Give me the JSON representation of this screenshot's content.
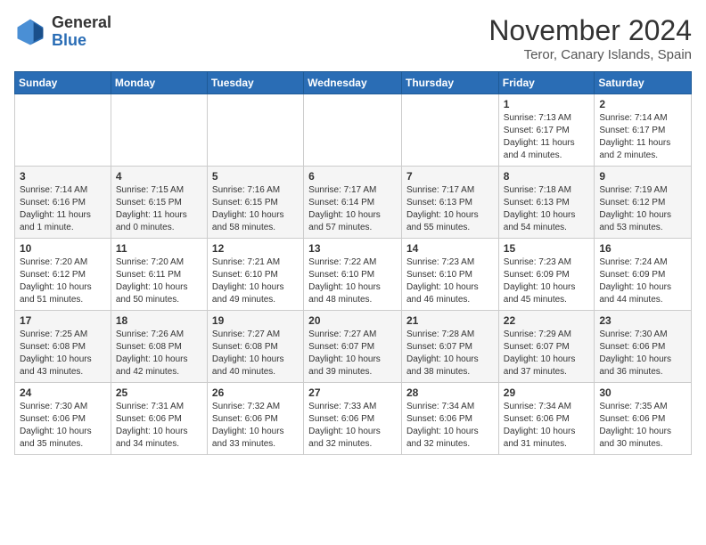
{
  "header": {
    "logo_general": "General",
    "logo_blue": "Blue",
    "month_title": "November 2024",
    "location": "Teror, Canary Islands, Spain"
  },
  "calendar": {
    "days_of_week": [
      "Sunday",
      "Monday",
      "Tuesday",
      "Wednesday",
      "Thursday",
      "Friday",
      "Saturday"
    ],
    "weeks": [
      [
        {
          "num": "",
          "info": ""
        },
        {
          "num": "",
          "info": ""
        },
        {
          "num": "",
          "info": ""
        },
        {
          "num": "",
          "info": ""
        },
        {
          "num": "",
          "info": ""
        },
        {
          "num": "1",
          "info": "Sunrise: 7:13 AM\nSunset: 6:17 PM\nDaylight: 11 hours\nand 4 minutes."
        },
        {
          "num": "2",
          "info": "Sunrise: 7:14 AM\nSunset: 6:17 PM\nDaylight: 11 hours\nand 2 minutes."
        }
      ],
      [
        {
          "num": "3",
          "info": "Sunrise: 7:14 AM\nSunset: 6:16 PM\nDaylight: 11 hours\nand 1 minute."
        },
        {
          "num": "4",
          "info": "Sunrise: 7:15 AM\nSunset: 6:15 PM\nDaylight: 11 hours\nand 0 minutes."
        },
        {
          "num": "5",
          "info": "Sunrise: 7:16 AM\nSunset: 6:15 PM\nDaylight: 10 hours\nand 58 minutes."
        },
        {
          "num": "6",
          "info": "Sunrise: 7:17 AM\nSunset: 6:14 PM\nDaylight: 10 hours\nand 57 minutes."
        },
        {
          "num": "7",
          "info": "Sunrise: 7:17 AM\nSunset: 6:13 PM\nDaylight: 10 hours\nand 55 minutes."
        },
        {
          "num": "8",
          "info": "Sunrise: 7:18 AM\nSunset: 6:13 PM\nDaylight: 10 hours\nand 54 minutes."
        },
        {
          "num": "9",
          "info": "Sunrise: 7:19 AM\nSunset: 6:12 PM\nDaylight: 10 hours\nand 53 minutes."
        }
      ],
      [
        {
          "num": "10",
          "info": "Sunrise: 7:20 AM\nSunset: 6:12 PM\nDaylight: 10 hours\nand 51 minutes."
        },
        {
          "num": "11",
          "info": "Sunrise: 7:20 AM\nSunset: 6:11 PM\nDaylight: 10 hours\nand 50 minutes."
        },
        {
          "num": "12",
          "info": "Sunrise: 7:21 AM\nSunset: 6:10 PM\nDaylight: 10 hours\nand 49 minutes."
        },
        {
          "num": "13",
          "info": "Sunrise: 7:22 AM\nSunset: 6:10 PM\nDaylight: 10 hours\nand 48 minutes."
        },
        {
          "num": "14",
          "info": "Sunrise: 7:23 AM\nSunset: 6:10 PM\nDaylight: 10 hours\nand 46 minutes."
        },
        {
          "num": "15",
          "info": "Sunrise: 7:23 AM\nSunset: 6:09 PM\nDaylight: 10 hours\nand 45 minutes."
        },
        {
          "num": "16",
          "info": "Sunrise: 7:24 AM\nSunset: 6:09 PM\nDaylight: 10 hours\nand 44 minutes."
        }
      ],
      [
        {
          "num": "17",
          "info": "Sunrise: 7:25 AM\nSunset: 6:08 PM\nDaylight: 10 hours\nand 43 minutes."
        },
        {
          "num": "18",
          "info": "Sunrise: 7:26 AM\nSunset: 6:08 PM\nDaylight: 10 hours\nand 42 minutes."
        },
        {
          "num": "19",
          "info": "Sunrise: 7:27 AM\nSunset: 6:08 PM\nDaylight: 10 hours\nand 40 minutes."
        },
        {
          "num": "20",
          "info": "Sunrise: 7:27 AM\nSunset: 6:07 PM\nDaylight: 10 hours\nand 39 minutes."
        },
        {
          "num": "21",
          "info": "Sunrise: 7:28 AM\nSunset: 6:07 PM\nDaylight: 10 hours\nand 38 minutes."
        },
        {
          "num": "22",
          "info": "Sunrise: 7:29 AM\nSunset: 6:07 PM\nDaylight: 10 hours\nand 37 minutes."
        },
        {
          "num": "23",
          "info": "Sunrise: 7:30 AM\nSunset: 6:06 PM\nDaylight: 10 hours\nand 36 minutes."
        }
      ],
      [
        {
          "num": "24",
          "info": "Sunrise: 7:30 AM\nSunset: 6:06 PM\nDaylight: 10 hours\nand 35 minutes."
        },
        {
          "num": "25",
          "info": "Sunrise: 7:31 AM\nSunset: 6:06 PM\nDaylight: 10 hours\nand 34 minutes."
        },
        {
          "num": "26",
          "info": "Sunrise: 7:32 AM\nSunset: 6:06 PM\nDaylight: 10 hours\nand 33 minutes."
        },
        {
          "num": "27",
          "info": "Sunrise: 7:33 AM\nSunset: 6:06 PM\nDaylight: 10 hours\nand 32 minutes."
        },
        {
          "num": "28",
          "info": "Sunrise: 7:34 AM\nSunset: 6:06 PM\nDaylight: 10 hours\nand 32 minutes."
        },
        {
          "num": "29",
          "info": "Sunrise: 7:34 AM\nSunset: 6:06 PM\nDaylight: 10 hours\nand 31 minutes."
        },
        {
          "num": "30",
          "info": "Sunrise: 7:35 AM\nSunset: 6:06 PM\nDaylight: 10 hours\nand 30 minutes."
        }
      ]
    ]
  }
}
